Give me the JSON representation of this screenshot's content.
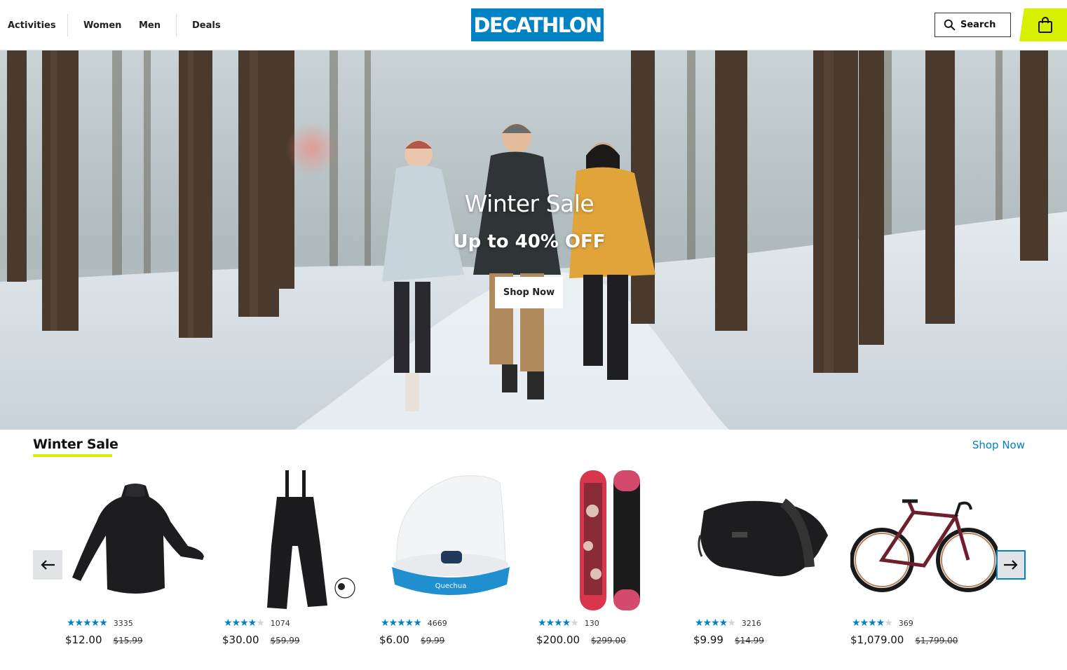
{
  "nav": {
    "activities": "Activities",
    "women": "Women",
    "men": "Men",
    "deals": "Deals"
  },
  "logo": "DECATHLON",
  "search": {
    "label": "Search",
    "icon": "search-icon"
  },
  "cart": {
    "icon": "shopping-bag-icon"
  },
  "hero": {
    "title": "Winter Sale",
    "subtitle": "Up to 40% OFF",
    "button": "Shop Now"
  },
  "section": {
    "title": "Winter Sale",
    "link": "Shop Now"
  },
  "colors": {
    "brand_blue": "#0082c3",
    "accent_lime": "#d7f000"
  },
  "products": [
    {
      "rating": 5.0,
      "reviews": "3335",
      "price": "$12.00",
      "old_price": "$15.99"
    },
    {
      "rating": 4.5,
      "reviews": "1074",
      "price": "$30.00",
      "old_price": "$59.99"
    },
    {
      "rating": 5.0,
      "reviews": "4669",
      "price": "$6.00",
      "old_price": "$9.99"
    },
    {
      "rating": 4.5,
      "reviews": "130",
      "price": "$200.00",
      "old_price": "$299.00"
    },
    {
      "rating": 4.5,
      "reviews": "3216",
      "price": "$9.99",
      "old_price": "$14.99"
    },
    {
      "rating": 4.0,
      "reviews": "369",
      "price": "$1,079.00",
      "old_price": "$1,799.00"
    }
  ]
}
